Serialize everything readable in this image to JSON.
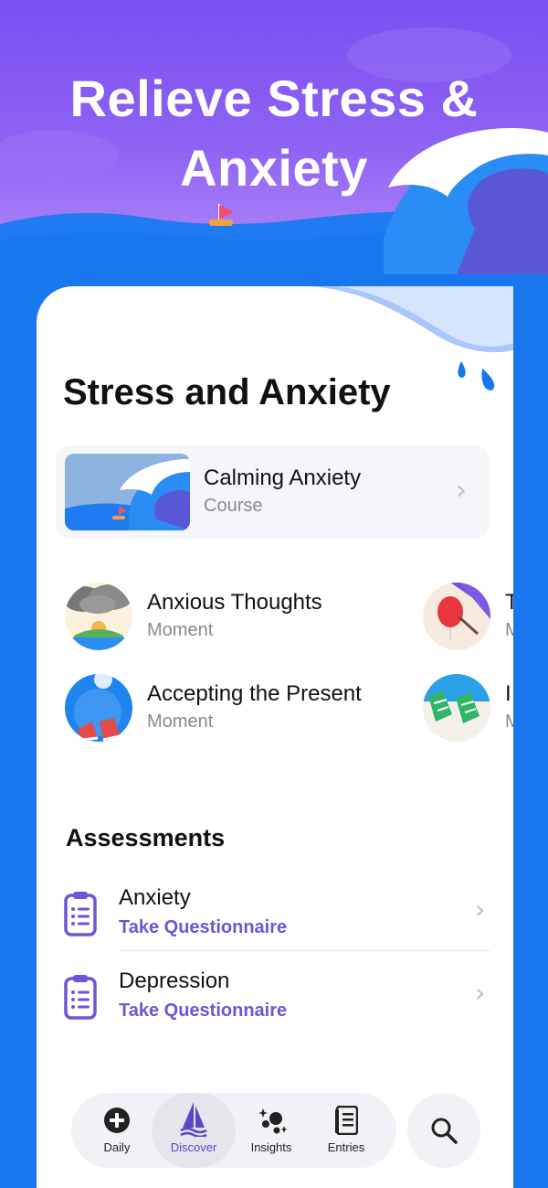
{
  "hero": {
    "title_line1": "Relieve Stress &",
    "title_line2": "Anxiety"
  },
  "section_title": "Stress and Anxiety",
  "course": {
    "title": "Calming Anxiety",
    "subtitle": "Course"
  },
  "moments": [
    {
      "title": "Anxious Thoughts",
      "subtitle": "Moment"
    },
    {
      "title": "Accepting the Present",
      "subtitle": "Moment"
    },
    {
      "title": "T",
      "subtitle": "M"
    },
    {
      "title": "I",
      "subtitle": "M"
    }
  ],
  "assessments": {
    "title": "Assessments",
    "items": [
      {
        "title": "Anxiety",
        "action": "Take Questionnaire"
      },
      {
        "title": "Depression",
        "action": "Take Questionnaire"
      }
    ]
  },
  "tabbar": {
    "tabs": [
      {
        "label": "Daily",
        "icon": "plus-circle-icon"
      },
      {
        "label": "Discover",
        "icon": "sailboat-icon",
        "active": true
      },
      {
        "label": "Insights",
        "icon": "sparkles-icon"
      },
      {
        "label": "Entries",
        "icon": "journal-icon"
      }
    ],
    "search_icon": "search-icon"
  },
  "colors": {
    "accent": "#6f54d8",
    "ocean": "#1877ef",
    "sky": "#8b5cf6"
  }
}
